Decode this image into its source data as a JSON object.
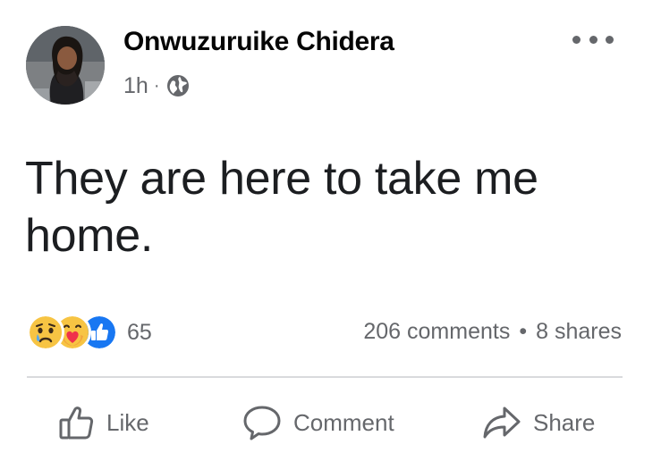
{
  "post": {
    "author": "Onwuzuruike Chidera",
    "time": "1h",
    "separator": "·",
    "text": "They are here to take me home.",
    "reaction_count": "65",
    "comments": "206 comments",
    "stats_separator": "•",
    "shares": "8 shares"
  },
  "reactions": [
    "sad-icon",
    "care-icon",
    "like-icon"
  ],
  "actions": {
    "like": "Like",
    "comment": "Comment",
    "share": "Share"
  },
  "colors": {
    "secondary_text": "#65676b",
    "like_blue": "#1877f2",
    "divider": "#d9dadd"
  }
}
